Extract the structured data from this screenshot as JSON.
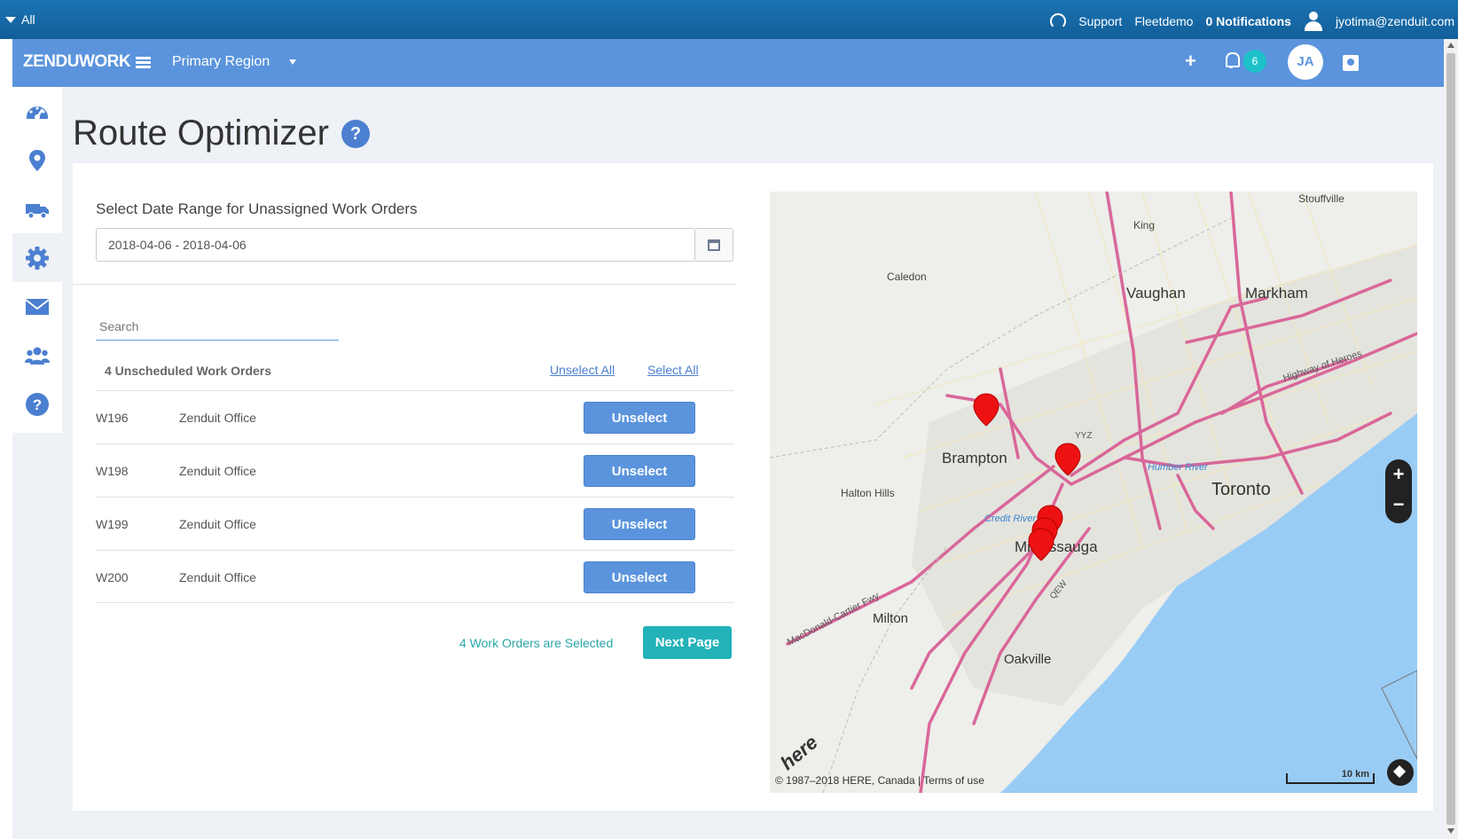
{
  "topbar": {
    "all_label": "All",
    "support_label": "Support",
    "fleet_label": "Fleetdemo",
    "notifications_label": "0 Notifications",
    "user_email": "jyotima@zenduit.com"
  },
  "navbar": {
    "brand": "ZENDUWORK",
    "region": "Primary Region",
    "plus_label": "+",
    "notification_count": "6",
    "avatar_initials": "JA"
  },
  "sidebar": {
    "items": [
      {
        "icon": "dashboard-icon"
      },
      {
        "icon": "map-marker-icon"
      },
      {
        "icon": "truck-icon"
      },
      {
        "icon": "gear-icon"
      },
      {
        "icon": "envelope-icon"
      },
      {
        "icon": "users-icon"
      },
      {
        "icon": "question-icon"
      }
    ]
  },
  "page": {
    "title": "Route Optimizer",
    "help": "?"
  },
  "form": {
    "date_label": "Select Date Range for Unassigned Work Orders",
    "date_value": "2018-04-06 - 2018-04-06",
    "search_placeholder": "Search"
  },
  "orders": {
    "count_label": "4 Unscheduled Work Orders",
    "unselect_all": "Unselect All",
    "select_all": "Select All",
    "rows": [
      {
        "id": "W196",
        "location": "Zenduit Office",
        "action": "Unselect"
      },
      {
        "id": "W198",
        "location": "Zenduit Office",
        "action": "Unselect"
      },
      {
        "id": "W199",
        "location": "Zenduit Office",
        "action": "Unselect"
      },
      {
        "id": "W200",
        "location": "Zenduit Office",
        "action": "Unselect"
      }
    ],
    "selected_text": "4 Work Orders are Selected",
    "next_label": "Next Page"
  },
  "map": {
    "labels": {
      "stouffville": "Stouffville",
      "king": "King",
      "caledon": "Caledon",
      "vaughan": "Vaughan",
      "markham": "Markham",
      "brampton": "Brampton",
      "halton_hills": "Halton Hills",
      "toronto": "Toronto",
      "mississauga": "Mississauga",
      "milton": "Milton",
      "oakville": "Oakville",
      "credit_river": "Credit River",
      "humber_river": "Humber River",
      "highway_heroes": "Highway of Heroes",
      "macdonald": "MacDonald-Cartier Fwy",
      "yyz": "YYZ",
      "qew": "QEW"
    },
    "zoom_in": "+",
    "zoom_out": "−",
    "copyright": "© 1987–2018 HERE, Canada | Terms of use",
    "scale": "10 km",
    "logo": "here",
    "colors": {
      "highway": "#d9679a",
      "water": "#99ccf5",
      "marker": "#ee1111"
    }
  }
}
